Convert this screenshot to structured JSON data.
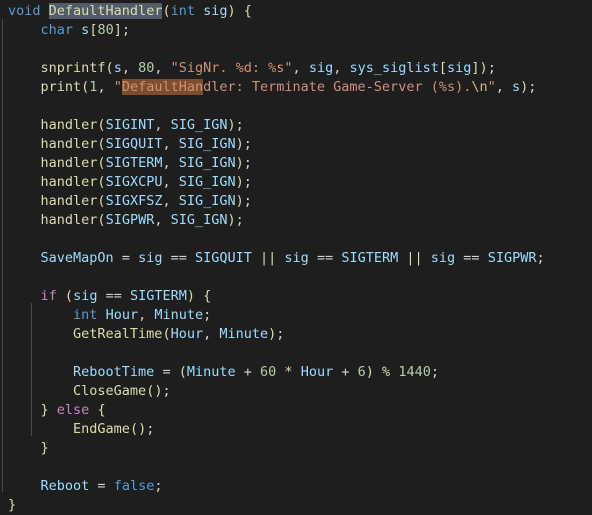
{
  "editor": {
    "language": "c",
    "background_color": "#1e1e1e",
    "default_text_color": "#d4d4d4",
    "selection_highlight_color": "#515c6a",
    "find_match_highlight_color": "#7d4e2d",
    "indent_guide_color": "#4a4a4a",
    "highlighted_symbol": "DefaultHandler",
    "find_match_text": "DefaultHan"
  },
  "code": {
    "line_01": "void DefaultHandler(int sig) {",
    "line_02": "    char s[80];",
    "line_03": "",
    "line_04": "    snprintf(s, 80, \"SigNr. %d: %s\", sig, sys_siglist[sig]);",
    "line_05": "    print(1, \"DefaultHandler: Terminate Game-Server (%s).\\n\", s);",
    "line_06": "",
    "line_07": "    handler(SIGINT, SIG_IGN);",
    "line_08": "    handler(SIGQUIT, SIG_IGN);",
    "line_09": "    handler(SIGTERM, SIG_IGN);",
    "line_10": "    handler(SIGXCPU, SIG_IGN);",
    "line_11": "    handler(SIGXFSZ, SIG_IGN);",
    "line_12": "    handler(SIGPWR, SIG_IGN);",
    "line_13": "",
    "line_14": "    SaveMapOn = sig == SIGQUIT || sig == SIGTERM || sig == SIGPWR;",
    "line_15": "",
    "line_16": "    if (sig == SIGTERM) {",
    "line_17": "        int Hour, Minute;",
    "line_18": "        GetRealTime(Hour, Minute);",
    "line_19": "",
    "line_20": "        RebootTime = (Minute + 60 * Hour + 6) % 1440;",
    "line_21": "        CloseGame();",
    "line_22": "    } else {",
    "line_23": "        EndGame();",
    "line_24": "    }",
    "line_25": "",
    "line_26": "    Reboot = false;",
    "line_27": "}"
  },
  "tokens": {
    "kw_void": "void",
    "kw_char": "char",
    "kw_int": "int",
    "kw_false": "false",
    "ctl_if": "if",
    "ctl_else": "else",
    "fn_DefaultHandler": "DefaultHandler",
    "fn_snprintf": "snprintf",
    "fn_print": "print",
    "fn_handler": "handler",
    "fn_GetRealTime": "GetRealTime",
    "fn_CloseGame": "CloseGame",
    "fn_EndGame": "EndGame",
    "var_sig": "sig",
    "var_s": "s",
    "var_sys_siglist": "sys_siglist",
    "var_SaveMapOn": "SaveMapOn",
    "var_Hour": "Hour",
    "var_Minute": "Minute",
    "var_RebootTime": "RebootTime",
    "var_Reboot": "Reboot",
    "const_SIGINT": "SIGINT",
    "const_SIGQUIT": "SIGQUIT",
    "const_SIGTERM": "SIGTERM",
    "const_SIGXCPU": "SIGXCPU",
    "const_SIGXFSZ": "SIGXFSZ",
    "const_SIGPWR": "SIGPWR",
    "const_SIG_IGN": "SIG_IGN",
    "num_80": "80",
    "num_1": "1",
    "num_60": "60",
    "num_6": "6",
    "num_1440": "1440",
    "str_signr": "\"SigNr. %d: %s\"",
    "str_terminate_prefix": "\"",
    "str_find_part": "DefaultHan",
    "str_terminate_rest": "dler: Terminate Game-Server (%s).",
    "str_escape_n": "\\n",
    "str_terminate_close": "\""
  }
}
